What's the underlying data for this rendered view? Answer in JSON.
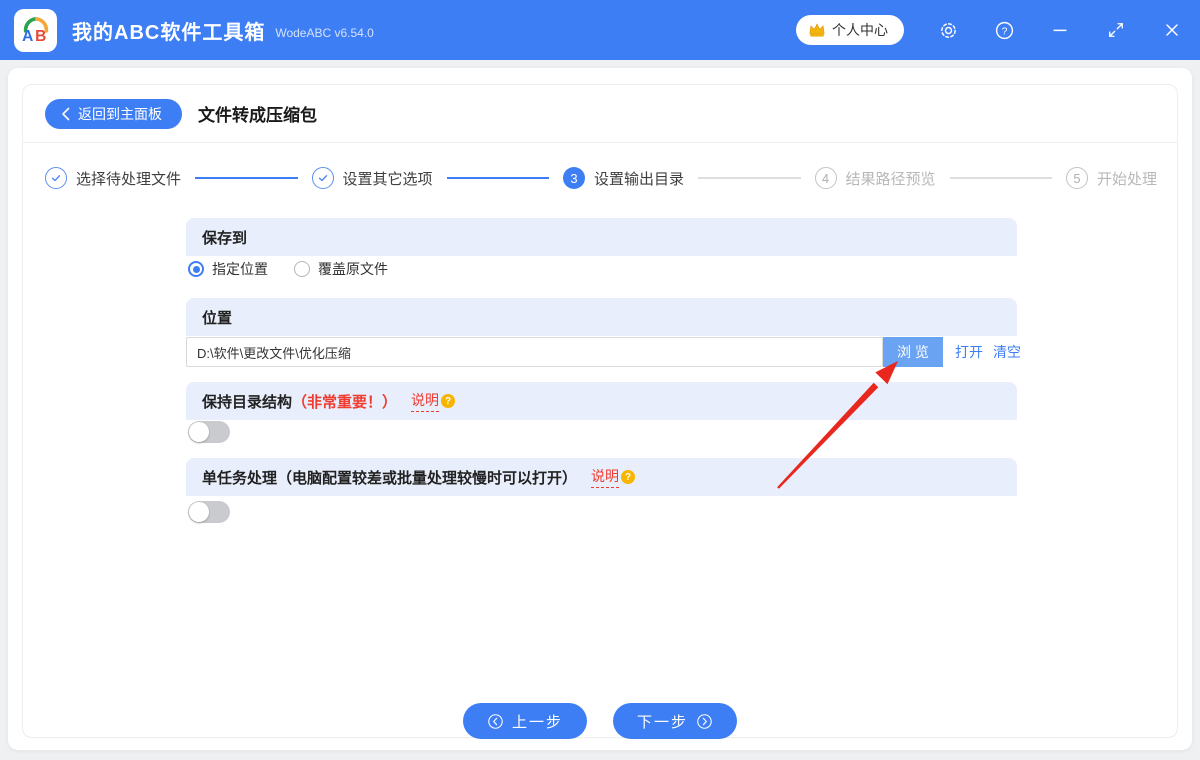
{
  "titlebar": {
    "logo_letter_a": "A",
    "logo_letter_b": "B",
    "app_title": "我的ABC软件工具箱",
    "version": "WodeABC v6.54.0",
    "user_center_label": "个人中心"
  },
  "header": {
    "back_label": "返回到主面板",
    "page_title": "文件转成压缩包"
  },
  "steps": [
    {
      "label": "选择待处理文件",
      "state": "done"
    },
    {
      "label": "设置其它选项",
      "state": "done"
    },
    {
      "label": "设置输出目录",
      "state": "active",
      "number": "3"
    },
    {
      "label": "结果路径预览",
      "state": "pending",
      "number": "4"
    },
    {
      "label": "开始处理",
      "state": "pending",
      "number": "5"
    }
  ],
  "save_to": {
    "title": "保存到",
    "options": [
      {
        "label": "指定位置",
        "selected": true
      },
      {
        "label": "覆盖原文件",
        "selected": false
      }
    ]
  },
  "location": {
    "title": "位置",
    "path_value": "D:\\软件\\更改文件\\优化压缩",
    "browse_label": "浏 览",
    "open_label": "打开",
    "clear_label": "清空"
  },
  "keep_structure": {
    "title": "保持目录结构",
    "important_note": "（非常重要！）",
    "help_label": "说明",
    "help_badge": "?",
    "toggle_on": false
  },
  "single_task": {
    "title": "单任务处理（电脑配置较差或批量处理较慢时可以打开）",
    "help_label": "说明",
    "help_badge": "?",
    "toggle_on": false
  },
  "footer": {
    "prev_label": "上一步",
    "next_label": "下一步"
  },
  "colors": {
    "titlebar_blue": "#3d7ef5",
    "accent_blue": "#3d7ef5",
    "section_bg": "#e8eefb",
    "browse_button_blue": "#6ba3f3",
    "warning_red": "#f03b30",
    "badge_orange": "#f7b500",
    "arrow_red": "#e8281e",
    "toggle_off_gray": "#c9cbce"
  }
}
